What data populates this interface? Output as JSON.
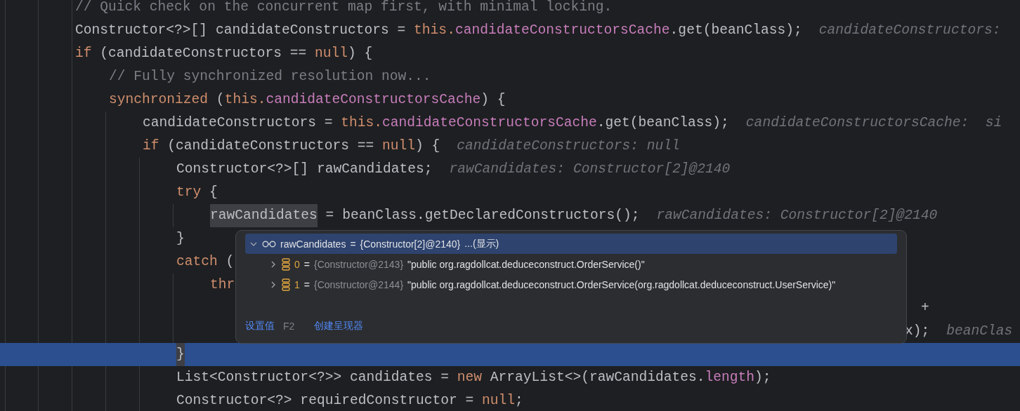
{
  "editor": {
    "lines": [
      {
        "current": false,
        "tokens": [
          {
            "kind": "comment",
            "text": "// Quick check on the concurrent map first, with minimal locking."
          }
        ]
      },
      {
        "current": false,
        "tokens": [
          {
            "kind": "plain",
            "text": "Constructor<?>[] candidateConstructors = "
          },
          {
            "kind": "keyword",
            "text": "this."
          },
          {
            "kind": "field",
            "text": "candidateConstructorsCache"
          },
          {
            "kind": "plain",
            "text": ".get(beanClass);"
          },
          {
            "kind": "hint",
            "text": "candidateConstructors:"
          }
        ]
      },
      {
        "current": false,
        "tokens": [
          {
            "kind": "keyword",
            "text": "if"
          },
          {
            "kind": "plain",
            "text": " (candidateConstructors == "
          },
          {
            "kind": "keyword",
            "text": "null"
          },
          {
            "kind": "plain",
            "text": ") {"
          }
        ],
        "children": [
          {
            "current": false,
            "tokens": [
              {
                "kind": "comment",
                "text": "// Fully synchronized resolution now..."
              }
            ]
          },
          {
            "current": false,
            "tokens": [
              {
                "kind": "keyword",
                "text": "synchronized"
              },
              {
                "kind": "plain",
                "text": " ("
              },
              {
                "kind": "keyword",
                "text": "this."
              },
              {
                "kind": "field",
                "text": "candidateConstructorsCache"
              },
              {
                "kind": "plain",
                "text": ") {"
              }
            ],
            "children": [
              {
                "current": false,
                "tokens": [
                  {
                    "kind": "plain",
                    "text": "candidateConstructors = "
                  },
                  {
                    "kind": "keyword",
                    "text": "this."
                  },
                  {
                    "kind": "field",
                    "text": "candidateConstructorsCache"
                  },
                  {
                    "kind": "plain",
                    "text": ".get(beanClass);"
                  },
                  {
                    "kind": "hint",
                    "text": "candidateConstructorsCache:  si"
                  }
                ]
              },
              {
                "current": false,
                "tokens": [
                  {
                    "kind": "keyword",
                    "text": "if"
                  },
                  {
                    "kind": "plain",
                    "text": " (candidateConstructors == "
                  },
                  {
                    "kind": "keyword",
                    "text": "null"
                  },
                  {
                    "kind": "plain",
                    "text": ") {"
                  },
                  {
                    "kind": "hint",
                    "text": "candidateConstructors: null"
                  }
                ],
                "children": [
                  {
                    "current": false,
                    "tokens": [
                      {
                        "kind": "plain",
                        "text": "Constructor<?>[] rawCandidates;"
                      },
                      {
                        "kind": "hint",
                        "text": "rawCandidates: Constructor[2]@2140"
                      }
                    ]
                  },
                  {
                    "current": false,
                    "tokens": [
                      {
                        "kind": "keyword",
                        "text": "try"
                      },
                      {
                        "kind": "plain",
                        "text": " {"
                      }
                    ],
                    "children": [
                      {
                        "current": false,
                        "tokens": [
                          {
                            "kind": "marked",
                            "text": "rawCandidates"
                          },
                          {
                            "kind": "plain",
                            "text": " = beanClass.getDeclaredConstructors();"
                          },
                          {
                            "kind": "hint",
                            "text": "rawCandidates: Constructor[2]@2140"
                          }
                        ]
                      }
                    ]
                  },
                  {
                    "current": false,
                    "tokens": [
                      {
                        "kind": "plain",
                        "text": "}"
                      }
                    ]
                  },
                  {
                    "current": false,
                    "tokens": [
                      {
                        "kind": "keyword",
                        "text": "catch"
                      },
                      {
                        "kind": "plain",
                        "text": " ("
                      }
                    ],
                    "children": [
                      {
                        "current": false,
                        "tokens": [
                          {
                            "kind": "keyword",
                            "text": "thr"
                          }
                        ]
                      },
                      {
                        "current": false,
                        "kind": "covered-end",
                        "tokens": [
                          {
                            "kind": "plain",
                            "text": "+"
                          }
                        ]
                      },
                      {
                        "current": false,
                        "kind": "covered",
                        "tokens": [
                          {
                            "kind": "plain",
                            "text": "x);"
                          },
                          {
                            "kind": "hint",
                            "text": "beanClas"
                          }
                        ]
                      }
                    ]
                  },
                  {
                    "current": true,
                    "tokens": [
                      {
                        "kind": "marked",
                        "text": "}"
                      }
                    ]
                  },
                  {
                    "current": false,
                    "tokens": [
                      {
                        "kind": "plain",
                        "text": "List<Constructor<?>> candidates = "
                      },
                      {
                        "kind": "keyword",
                        "text": "new"
                      },
                      {
                        "kind": "plain",
                        "text": " ArrayList<>(rawCandidates."
                      },
                      {
                        "kind": "field",
                        "text": "length"
                      },
                      {
                        "kind": "plain",
                        "text": ");"
                      }
                    ]
                  },
                  {
                    "current": false,
                    "tokens": [
                      {
                        "kind": "plain",
                        "text": "Constructor<?> requiredConstructor = "
                      },
                      {
                        "kind": "keyword",
                        "text": "null"
                      },
                      {
                        "kind": "plain",
                        "text": ";"
                      }
                    ]
                  }
                ]
              }
            ]
          }
        ]
      }
    ]
  },
  "debug_popup": {
    "rows": [
      {
        "kind": "root",
        "selected": true,
        "expanded": true,
        "name": "rawCandidates",
        "operator": "=",
        "type": "{Constructor[2]@2140}",
        "value": "...(显示)"
      },
      {
        "kind": "element",
        "selected": false,
        "expanded": false,
        "name": "0",
        "operator": "=",
        "type": "{Constructor@2143}",
        "value": "\"public org.ragdollcat.deduceconstruct.OrderService()\""
      },
      {
        "kind": "element",
        "selected": false,
        "expanded": false,
        "name": "1",
        "operator": "=",
        "type": "{Constructor@2144}",
        "value": "\"public org.ragdollcat.deduceconstruct.OrderService(org.ragdollcat.deduceconstruct.UserService)\""
      }
    ],
    "actions": [
      {
        "label": "设置值",
        "shortcut": "F2"
      },
      {
        "label": "创建呈现器"
      }
    ]
  }
}
